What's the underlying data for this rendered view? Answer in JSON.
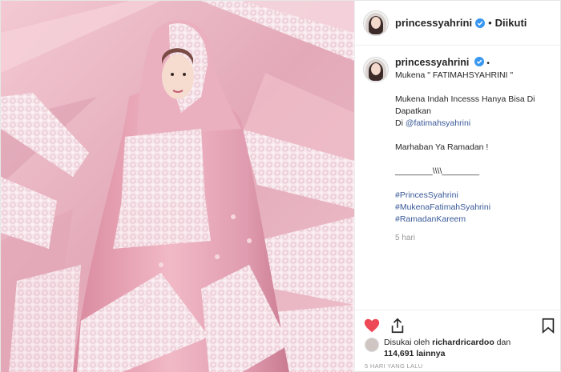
{
  "header": {
    "username": "princessyahrini",
    "separator": "•",
    "follow_status": "Diikuti"
  },
  "caption": {
    "username": "princessyahrini",
    "separator": "•",
    "lines": [
      "Mukena \" FATIMAHSYAHRINI \"",
      "",
      "Mukena Indah Incesss Hanya Bisa Di",
      "Dapatkan",
      "Di",
      "",
      "Marhaban Ya Ramadan !",
      "",
      "________\\\\\\\\________",
      ""
    ],
    "mention": "@fatimahsyahrini",
    "hashtags": [
      "#PrincesSyahrini",
      "#MukenaFatimahSyahrini",
      "#RamadanKareem"
    ],
    "time": "5 hari"
  },
  "likes": {
    "prefix": "Disukai oleh",
    "user": "richardricardoo",
    "conj": "dan",
    "count": "114,691 lainnya"
  },
  "posted_ago": "5 HARI YANG LALU",
  "icons": {
    "like": "heart-icon",
    "share": "share-icon",
    "save": "bookmark-icon",
    "verified": "verified-badge-icon"
  },
  "colors": {
    "like": "#ed4956",
    "verified": "#3897f0",
    "link": "#385898",
    "photo_pink": "#e9b7c3"
  }
}
